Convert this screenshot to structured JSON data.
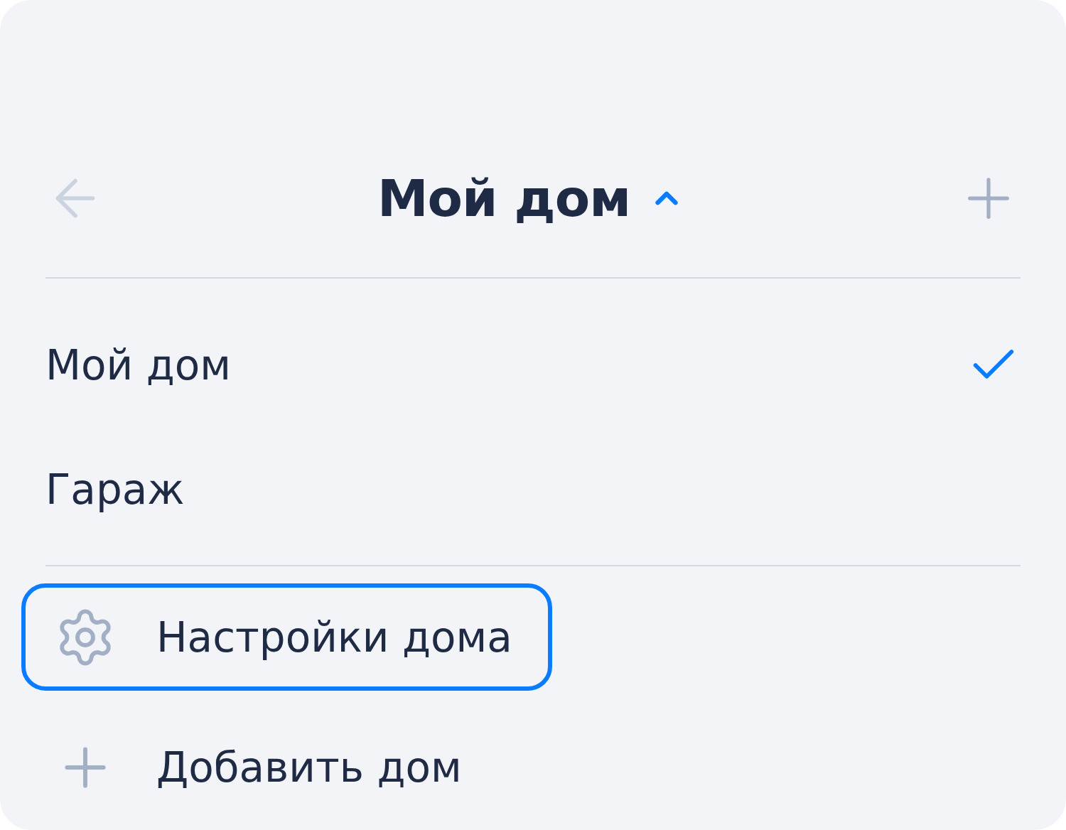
{
  "header": {
    "title": "Мой дом",
    "expanded": true,
    "back_disabled": true
  },
  "homes": [
    {
      "name": "Мой дом",
      "selected": true
    },
    {
      "name": "Гараж",
      "selected": false
    }
  ],
  "actions": [
    {
      "kind": "settings",
      "label": "Настройки дома",
      "focused": true
    },
    {
      "kind": "add",
      "label": "Добавить дом",
      "focused": false
    }
  ]
}
